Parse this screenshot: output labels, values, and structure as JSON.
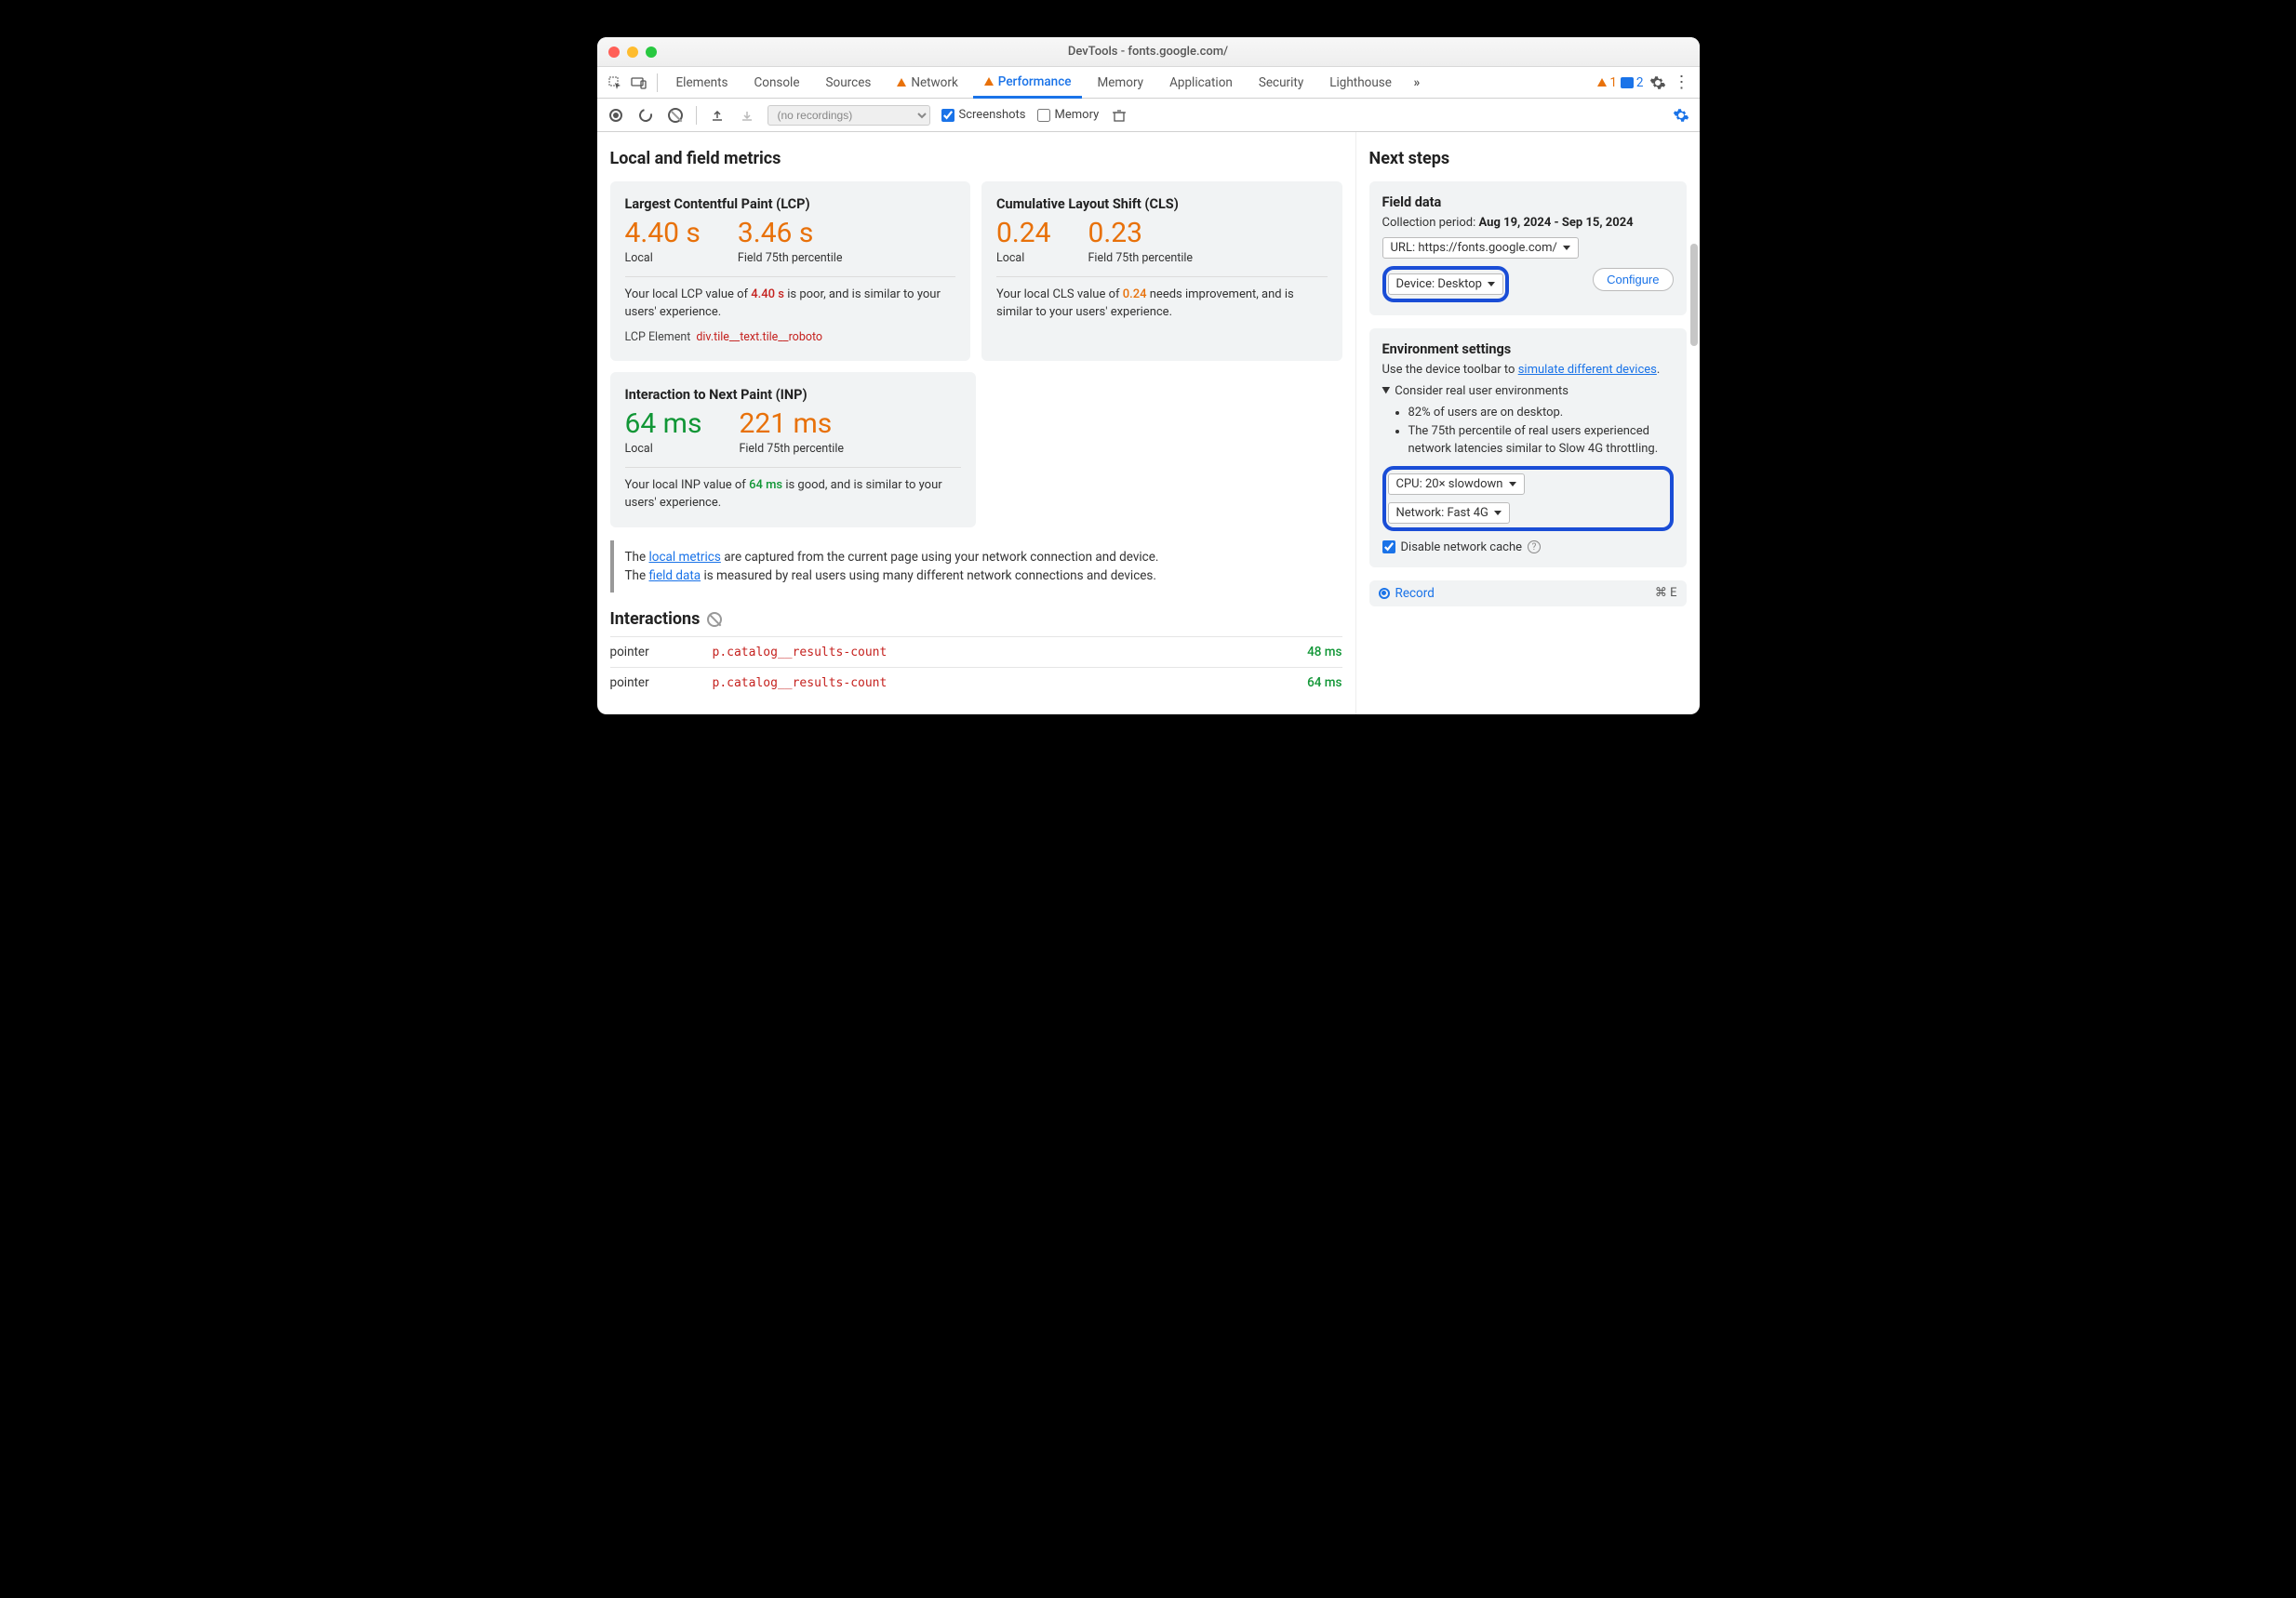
{
  "window": {
    "title": "DevTools - fonts.google.com/"
  },
  "tabs": {
    "items": [
      "Elements",
      "Console",
      "Sources",
      "Network",
      "Performance",
      "Memory",
      "Application",
      "Security",
      "Lighthouse"
    ],
    "active": "Performance",
    "warn_on": [
      "Network",
      "Performance"
    ],
    "status": {
      "warnings": "1",
      "messages": "2"
    }
  },
  "toolbar": {
    "recordings_placeholder": "(no recordings)",
    "screenshots_label": "Screenshots",
    "memory_label": "Memory",
    "screenshots_checked": true,
    "memory_checked": false
  },
  "metrics": {
    "heading": "Local and field metrics",
    "lcp": {
      "title": "Largest Contentful Paint (LCP)",
      "local": "4.40 s",
      "local_label": "Local",
      "field": "3.46 s",
      "field_label": "Field 75th percentile",
      "desc_pre": "Your local LCP value of ",
      "desc_val": "4.40 s",
      "desc_post": " is poor, and is similar to your users' experience.",
      "el_label": "LCP Element",
      "el_val": "div.tile__text.tile__roboto"
    },
    "cls": {
      "title": "Cumulative Layout Shift (CLS)",
      "local": "0.24",
      "local_label": "Local",
      "field": "0.23",
      "field_label": "Field 75th percentile",
      "desc_pre": "Your local CLS value of ",
      "desc_val": "0.24",
      "desc_post": " needs improvement, and is similar to your users' experience."
    },
    "inp": {
      "title": "Interaction to Next Paint (INP)",
      "local": "64 ms",
      "local_label": "Local",
      "field": "221 ms",
      "field_label": "Field 75th percentile",
      "desc_pre": "Your local INP value of ",
      "desc_val": "64 ms",
      "desc_post": " is good, and is similar to your users' experience."
    },
    "info_line1a": "The ",
    "info_link1": "local metrics",
    "info_line1b": " are captured from the current page using your network connection and device.",
    "info_line2a": "The ",
    "info_link2": "field data",
    "info_line2b": " is measured by real users using many different network connections and devices."
  },
  "interactions": {
    "heading": "Interactions",
    "rows": [
      {
        "type": "pointer",
        "target": "p.catalog__results-count",
        "time": "48 ms"
      },
      {
        "type": "pointer",
        "target": "p.catalog__results-count",
        "time": "64 ms"
      }
    ]
  },
  "next": {
    "heading": "Next steps",
    "field": {
      "title": "Field data",
      "period_label": "Collection period: ",
      "period_value": "Aug 19, 2024 - Sep 15, 2024",
      "url_select": "URL: https://fonts.google.com/",
      "device_select": "Device: Desktop",
      "configure": "Configure"
    },
    "env": {
      "title": "Environment settings",
      "hint_pre": "Use the device toolbar to ",
      "hint_link": "simulate different devices",
      "hint_post": ".",
      "details_label": "Consider real user environments",
      "bullet1": "82% of users are on desktop.",
      "bullet2": "The 75th percentile of real users experienced network latencies similar to Slow 4G throttling.",
      "cpu_select": "CPU: 20× slowdown",
      "net_select": "Network: Fast 4G",
      "disable_cache": "Disable network cache"
    },
    "record": {
      "label": "Record",
      "shortcut": "⌘ E"
    }
  }
}
